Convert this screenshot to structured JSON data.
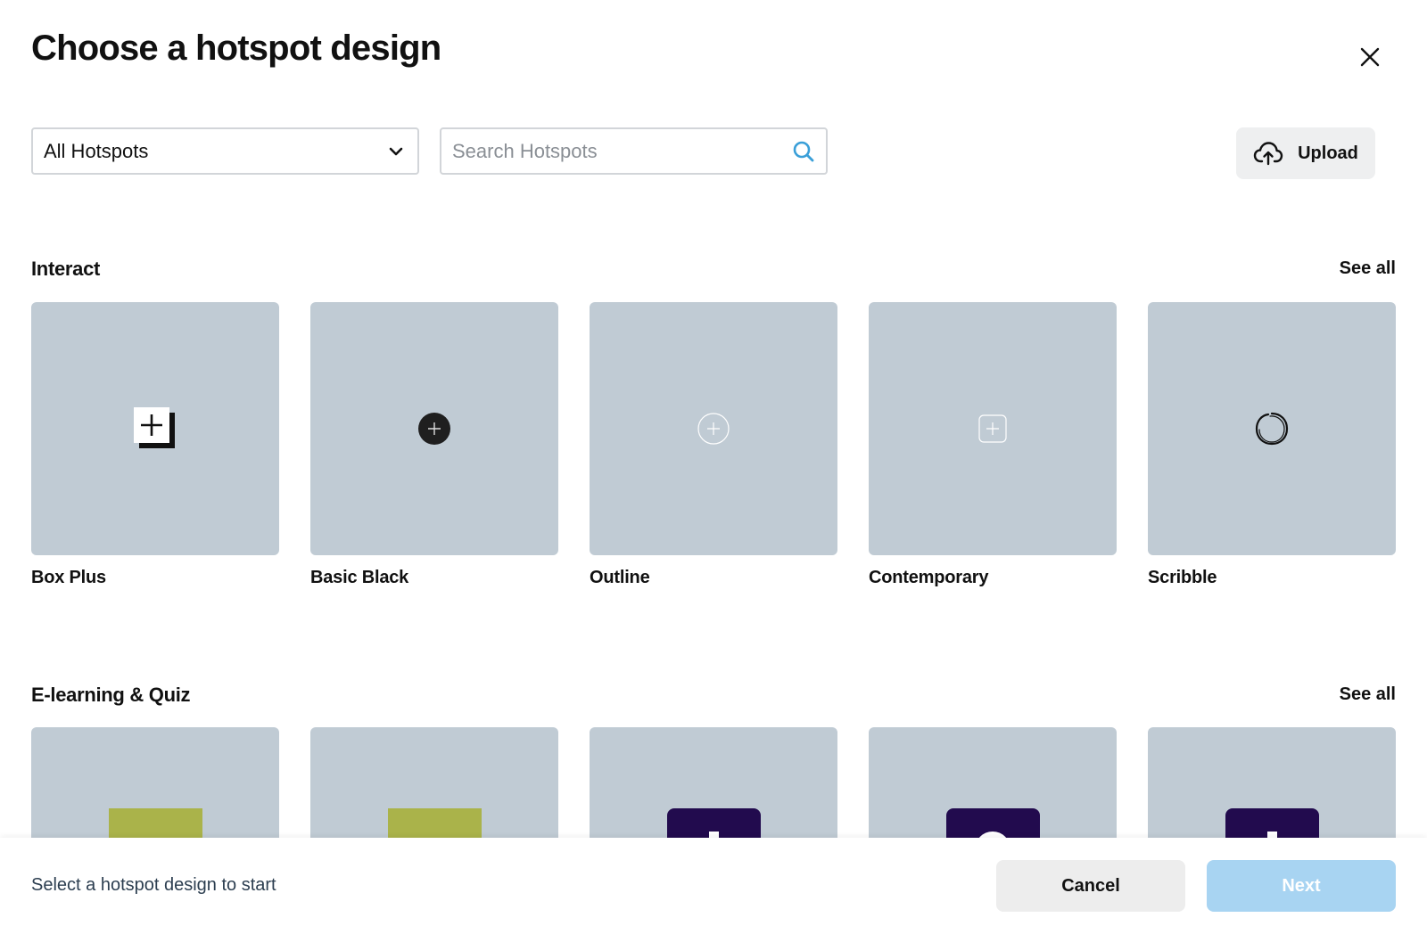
{
  "dialog": {
    "title": "Choose a hotspot design",
    "close_icon": "close-icon"
  },
  "filters": {
    "category_value": "All Hotspots",
    "category_icon": "chevron-down-icon",
    "search_placeholder": "Search Hotspots",
    "search_value": "",
    "search_icon": "search-icon",
    "search_icon_color": "#3a9fd8",
    "upload_label": "Upload",
    "upload_icon": "cloud-upload-icon"
  },
  "sections": [
    {
      "title": "Interact",
      "see_all": "See all",
      "items": [
        {
          "label": "Box Plus",
          "icon": "box-plus-icon"
        },
        {
          "label": "Basic Black",
          "icon": "black-circle-plus-icon"
        },
        {
          "label": "Outline",
          "icon": "outline-circle-plus-icon"
        },
        {
          "label": "Contemporary",
          "icon": "rounded-square-plus-icon"
        },
        {
          "label": "Scribble",
          "icon": "scribble-circle-icon"
        }
      ]
    },
    {
      "title": "E-learning & Quiz",
      "see_all": "See all",
      "items": [
        {
          "icon": "olive-square-icon",
          "color": "#aab34a"
        },
        {
          "icon": "olive-square-icon",
          "color": "#aab34a"
        },
        {
          "icon": "navy-plus-icon",
          "color": "#220b4e"
        },
        {
          "icon": "navy-question-icon",
          "color": "#220b4e"
        },
        {
          "icon": "navy-exclamation-icon",
          "color": "#220b4e"
        }
      ]
    }
  ],
  "footer": {
    "hint": "Select a hotspot design to start",
    "cancel_label": "Cancel",
    "next_label": "Next",
    "next_color": "#a8d4f2"
  },
  "colors": {
    "card_background": "#c0cbd4",
    "accent": "#3a9fd8"
  }
}
